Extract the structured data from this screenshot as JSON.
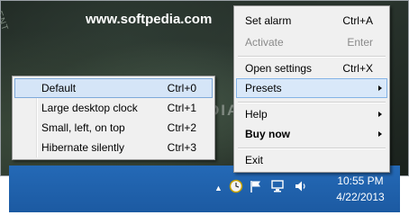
{
  "background": {
    "partial_text": "ENT",
    "watermark_top": "www.softpedia.com",
    "watermark_mid": "SOFTPEDIA"
  },
  "main_menu": {
    "items": [
      {
        "label": "Set alarm",
        "shortcut": "Ctrl+A",
        "state": "normal"
      },
      {
        "label": "Activate",
        "shortcut": "Enter",
        "state": "disabled"
      },
      {
        "label": "Open settings",
        "shortcut": "Ctrl+X",
        "state": "normal"
      },
      {
        "label": "Presets",
        "shortcut": "",
        "state": "highlighted",
        "submenu": true
      },
      {
        "label": "Help",
        "shortcut": "",
        "state": "normal",
        "submenu": true
      },
      {
        "label": "Buy now",
        "shortcut": "",
        "state": "bold",
        "submenu": true
      },
      {
        "label": "Exit",
        "shortcut": "",
        "state": "normal"
      }
    ]
  },
  "presets_submenu": {
    "items": [
      {
        "label": "Default",
        "shortcut": "Ctrl+0",
        "state": "highlighted"
      },
      {
        "label": "Large desktop clock",
        "shortcut": "Ctrl+1",
        "state": "normal"
      },
      {
        "label": "Small, left, on top",
        "shortcut": "Ctrl+2",
        "state": "normal"
      },
      {
        "label": "Hibernate silently",
        "shortcut": "Ctrl+3",
        "state": "normal"
      }
    ]
  },
  "taskbar": {
    "tray_icons": [
      "show-hidden-icons-arrow",
      "app-clock-icon",
      "flag-icon",
      "network-icon",
      "volume-icon"
    ],
    "time": "10:55 PM",
    "date": "4/22/2013"
  },
  "colors": {
    "taskbar": "#1e5fa8",
    "menu_bg": "#f0f0f0",
    "highlight": "#d9e8f9"
  }
}
